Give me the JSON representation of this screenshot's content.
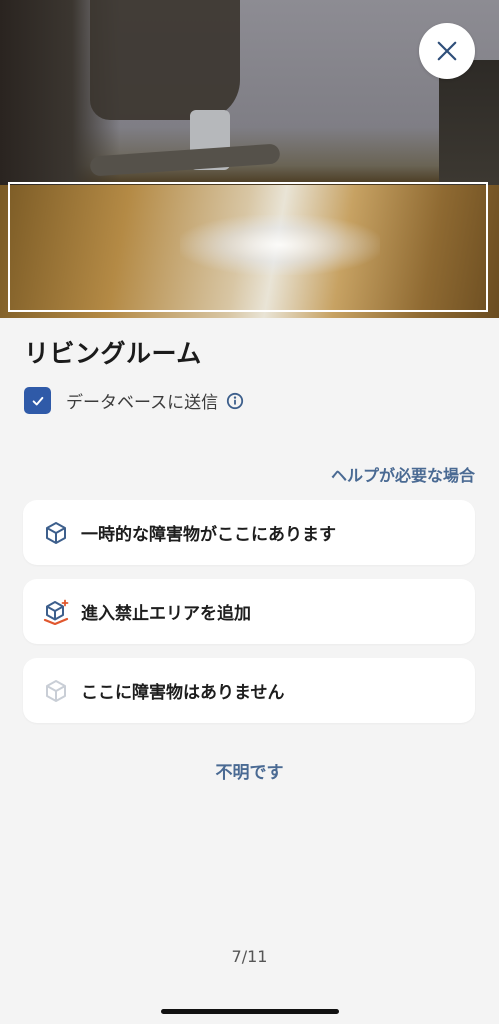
{
  "room_title": "リビングルーム",
  "send_to_database": {
    "label": "データベースに送信",
    "checked": true
  },
  "help_link": "ヘルプが必要な場合",
  "options": [
    {
      "label": "一時的な障害物がここにあります",
      "icon": "cube-icon"
    },
    {
      "label": "進入禁止エリアを追加",
      "icon": "no-go-zone-icon"
    },
    {
      "label": "ここに障害物はありません",
      "icon": "cube-outline-icon"
    }
  ],
  "unknown_link": "不明です",
  "page_indicator": "7/11",
  "colors": {
    "accent": "#2f5aa8",
    "link": "#4a6a93",
    "background": "#f4f4f4",
    "card": "#ffffff",
    "no_go_accent": "#e0572e"
  }
}
